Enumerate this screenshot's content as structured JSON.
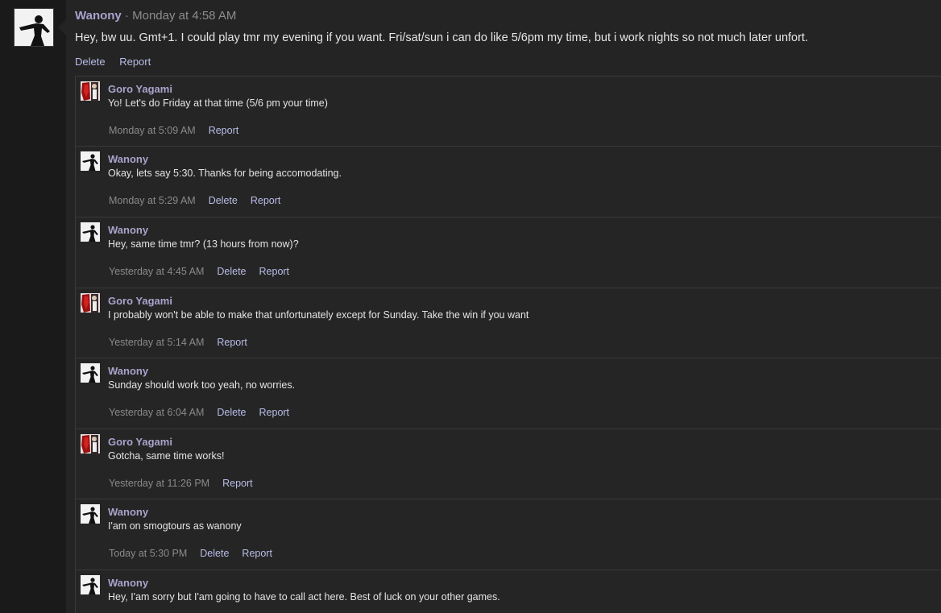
{
  "post": {
    "author": "Wanony",
    "separator": "·",
    "time": "Monday at 4:58 AM",
    "text": "Hey, bw uu. Gmt+1. I could play tmr my evening if you want. Fri/sat/sun i can do like 5/6pm my time, but i work nights so not much later unfort.",
    "delete_label": "Delete",
    "report_label": "Report"
  },
  "comments": [
    {
      "author": "Goro Yagami",
      "avatar": "goro-avatar",
      "text": "Yo! Let's do Friday at that time (5/6 pm your time)",
      "time": "Monday at 5:09 AM",
      "delete_label": "",
      "report_label": "Report"
    },
    {
      "author": "Wanony",
      "avatar": "wanony-avatar",
      "text": "Okay, lets say 5:30. Thanks for being accomodating.",
      "time": "Monday at 5:29 AM",
      "delete_label": "Delete",
      "report_label": "Report"
    },
    {
      "author": "Wanony",
      "avatar": "wanony-avatar",
      "text": "Hey, same time tmr? (13 hours from now)?",
      "time": "Yesterday at 4:45 AM",
      "delete_label": "Delete",
      "report_label": "Report"
    },
    {
      "author": "Goro Yagami",
      "avatar": "goro-avatar",
      "text": "I probably won't be able to make that unfortunately except for Sunday. Take the win if you want",
      "time": "Yesterday at 5:14 AM",
      "delete_label": "",
      "report_label": "Report"
    },
    {
      "author": "Wanony",
      "avatar": "wanony-avatar",
      "text": "Sunday should work too yeah, no worries.",
      "time": "Yesterday at 6:04 AM",
      "delete_label": "Delete",
      "report_label": "Report"
    },
    {
      "author": "Goro Yagami",
      "avatar": "goro-avatar",
      "text": "Gotcha, same time works!",
      "time": "Yesterday at 11:26 PM",
      "delete_label": "",
      "report_label": "Report"
    },
    {
      "author": "Wanony",
      "avatar": "wanony-avatar",
      "text": "I'am on smogtours as wanony",
      "time": "Today at 5:30 PM",
      "delete_label": "Delete",
      "report_label": "Report"
    },
    {
      "author": "Wanony",
      "avatar": "wanony-avatar",
      "text": "Hey, I'am sorry but I'am going to have to call act here. Best of luck on your other games.",
      "time": "",
      "delete_label": "",
      "report_label": ""
    }
  ],
  "colors": {
    "username": "#a9a3cc",
    "link": "#b9bde8",
    "meta": "#8a8a8a",
    "text": "#e4e4e4",
    "background": "#242424"
  }
}
